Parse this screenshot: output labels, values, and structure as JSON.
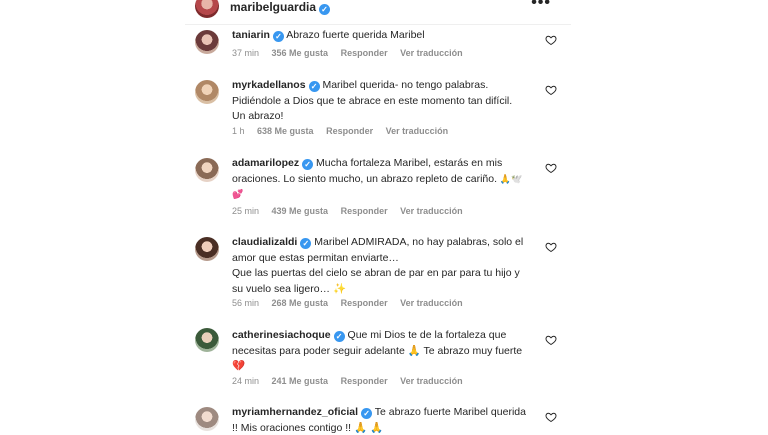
{
  "header": {
    "username": "maribelguardia",
    "more": "•••"
  },
  "comments": [
    {
      "user": "taniarin",
      "text": "Abrazo fuerte querida Maribel",
      "time": "37 min",
      "likes": "356 Me gusta",
      "reply": "Responder",
      "translate": "Ver traducción"
    },
    {
      "user": "myrkadellanos",
      "lines": [
        "Maribel querida- no tengo palabras.",
        "Pidiéndole a Dios que te abrace en este momento tan difícil.",
        "Un abrazo!"
      ],
      "time": "1 h",
      "likes": "638 Me gusta",
      "reply": "Responder",
      "translate": "Ver traducción"
    },
    {
      "user": "adamarilopez",
      "lines": [
        "Mucha fortaleza Maribel, estarás en mis",
        "oraciones. Lo siento mucho, un abrazo repleto de cariño."
      ],
      "emoji_line": "🙏🕊️💕",
      "time": "25 min",
      "likes": "439 Me gusta",
      "reply": "Responder",
      "translate": "Ver traducción"
    },
    {
      "user": "claudializaldi",
      "lines": [
        "Maribel ADMIRADA, no hay palabras, solo el",
        "amor que estas permitan enviarte…",
        "Que las puertas del cielo se abran de par en par para tu hijo y",
        "su vuelo sea ligero… ✨"
      ],
      "time": "56 min",
      "likes": "268 Me gusta",
      "reply": "Responder",
      "translate": "Ver traducción"
    },
    {
      "user": "catherinesiachoque",
      "lines": [
        "Que mi Dios te de la fortaleza que",
        "necesitas para poder seguir adelante 🙏 Te abrazo muy fuerte",
        "💔"
      ],
      "time": "24 min",
      "likes": "241 Me gusta",
      "reply": "Responder",
      "translate": "Ver traducción"
    },
    {
      "user": "myriamhernandez_oficial",
      "lines": [
        "Te abrazo fuerte Maribel querida",
        "!! Mis oraciones contigo !! 🙏 🙏"
      ]
    }
  ],
  "verified_mark": "✓",
  "colors": {
    "verified": "#3897f0",
    "meta": "#8e8e8e",
    "text": "#262626"
  }
}
